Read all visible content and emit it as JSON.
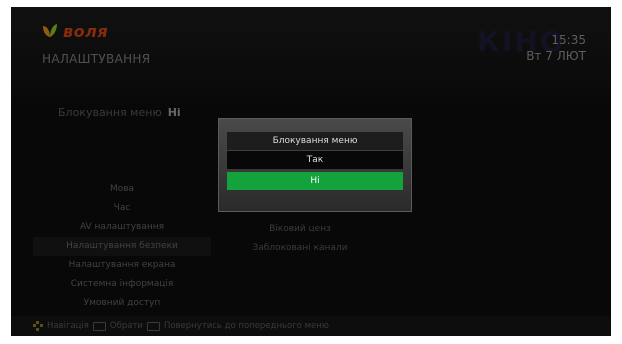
{
  "header": {
    "brand": "воля",
    "title": "НАЛАШТУВАННЯ",
    "time": "15:35",
    "date": "Вт 7 ЛЮТ",
    "bg_brand": "КІНО"
  },
  "status": {
    "label": "Блокування меню",
    "value": "Ні"
  },
  "menu": {
    "left": [
      "Мова",
      "Час",
      "AV налаштування",
      "Налаштування безпеки",
      "Налаштування екрана",
      "Системна інформація",
      "Умовний доступ"
    ],
    "right": [
      "Змінити PIN",
      "Віковий ценз",
      "Заблоковані канали"
    ]
  },
  "dialog": {
    "title": "Блокування меню",
    "options": [
      "Так",
      "Ні"
    ],
    "selected": "Ні"
  },
  "footer": {
    "navigate": "Навігація",
    "select": "Обрати",
    "back": "Повернутись до попереднього меню"
  },
  "colors": {
    "accent": "#13a23c",
    "brand": "#b43a12"
  },
  "icons": [
    "voliya-logo-icon",
    "dpad-icon",
    "ok-key-icon",
    "back-key-icon"
  ]
}
